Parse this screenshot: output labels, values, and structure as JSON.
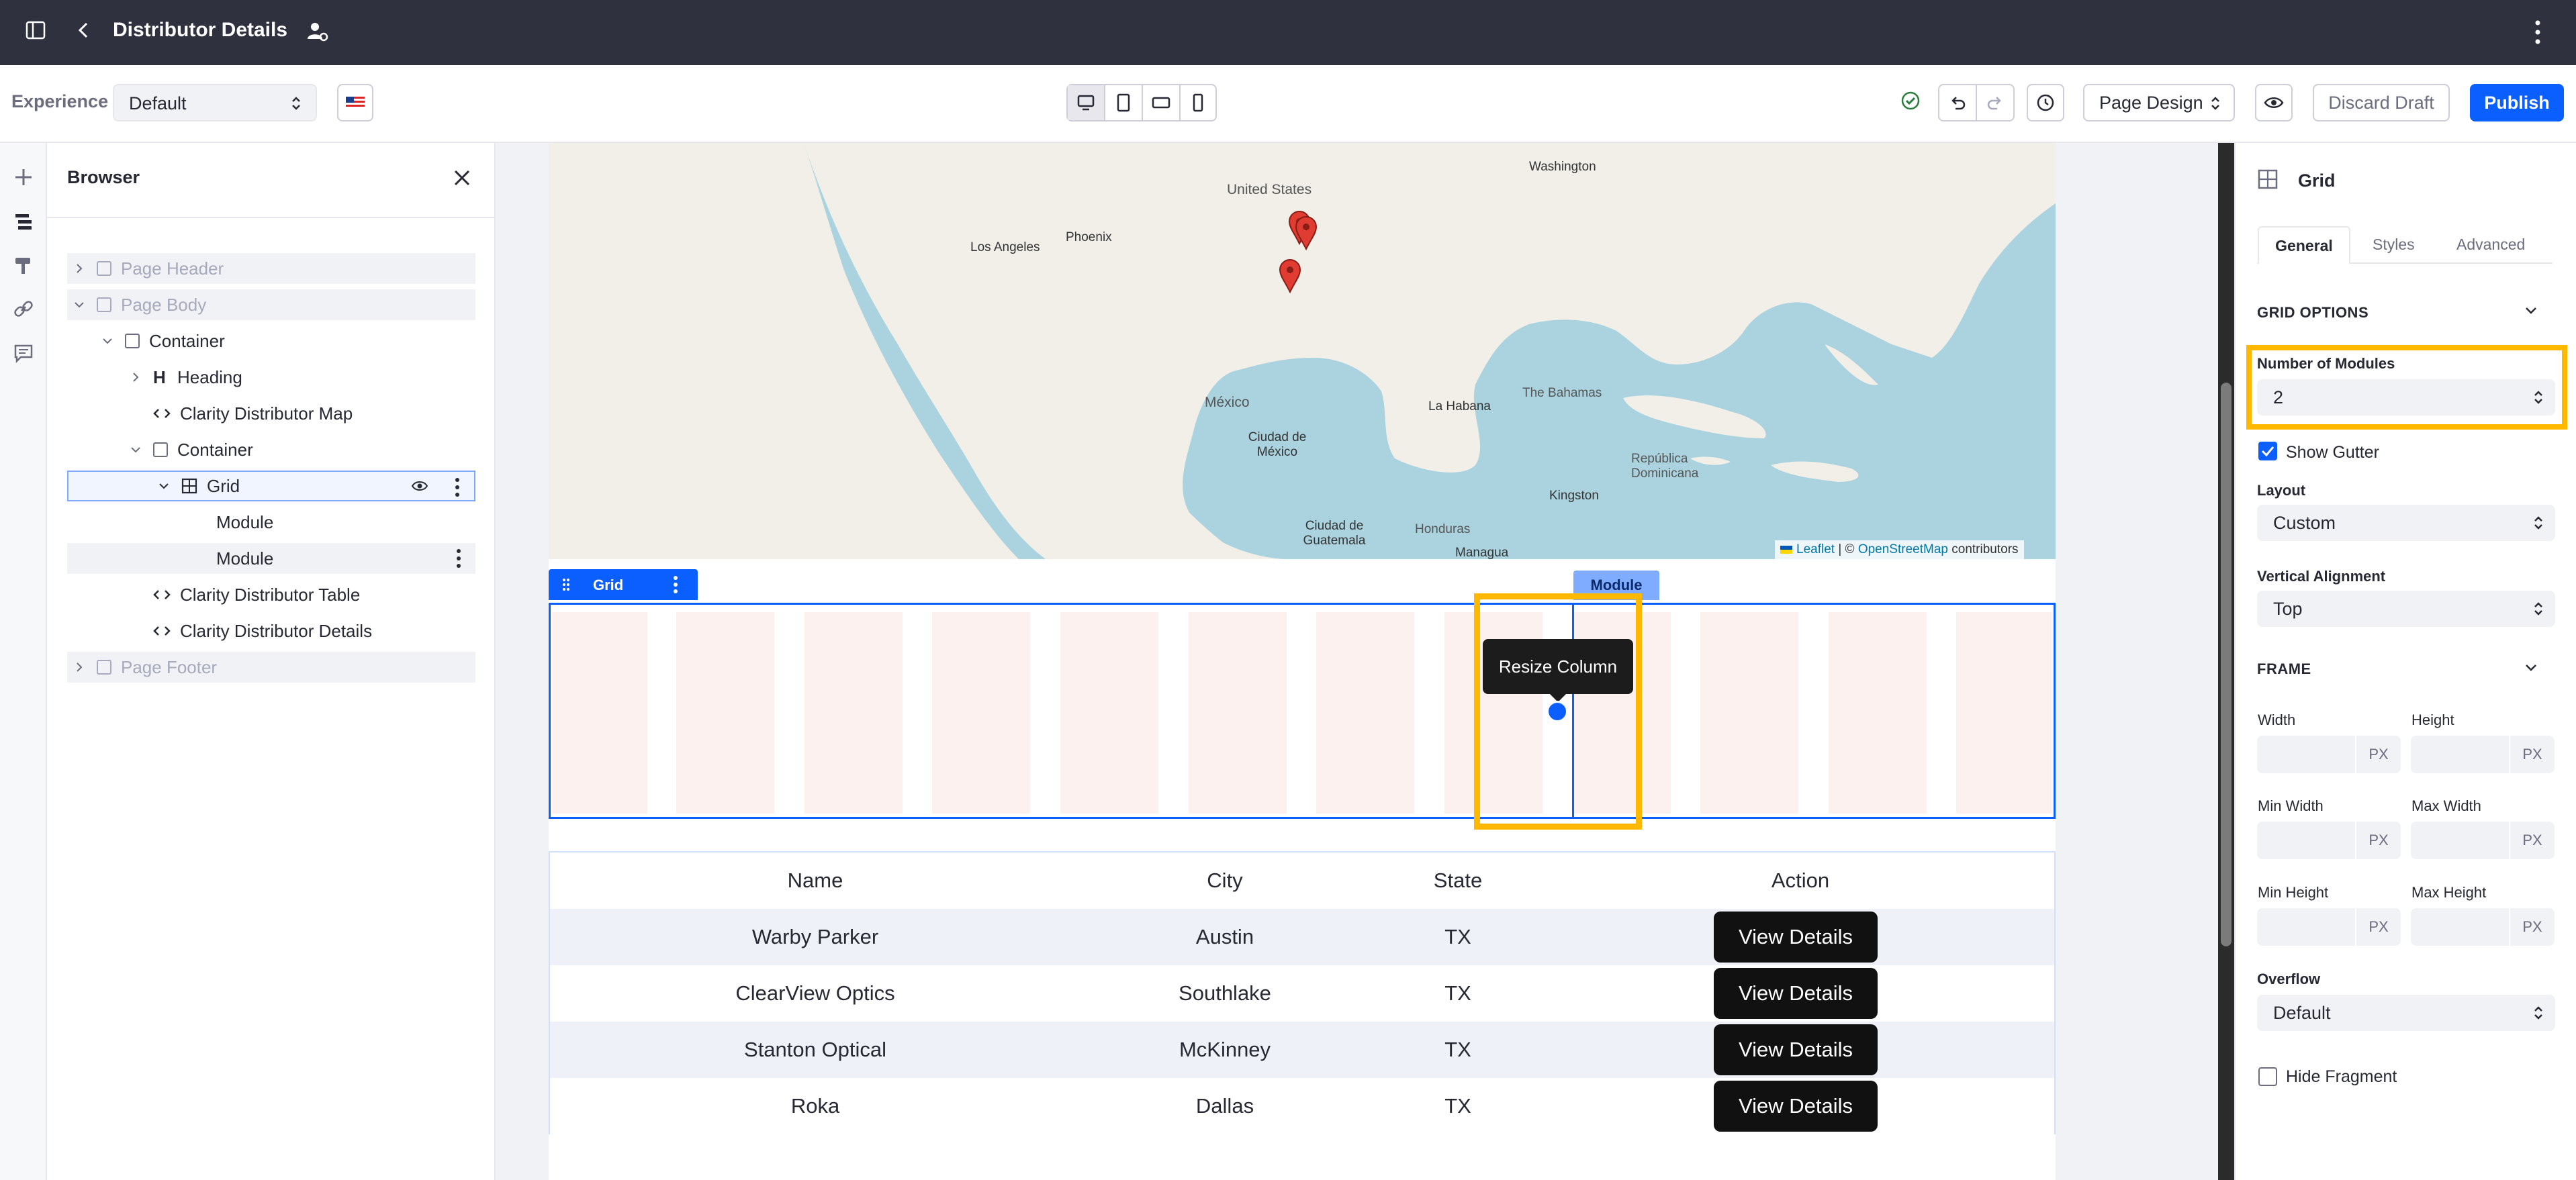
{
  "topbar": {
    "title": "Distributor Details"
  },
  "experience_bar": {
    "label": "Experience",
    "selected": "Default",
    "page_design_label": "Page Design",
    "discard_label": "Discard Draft",
    "publish_label": "Publish"
  },
  "browser": {
    "title": "Browser",
    "items": [
      {
        "label": "Page Header"
      },
      {
        "label": "Page Body"
      },
      {
        "label": "Container"
      },
      {
        "label": "Heading"
      },
      {
        "label": "Clarity Distributor Map"
      },
      {
        "label": "Container"
      },
      {
        "label": "Grid"
      },
      {
        "label": "Module"
      },
      {
        "label": "Module"
      },
      {
        "label": "Clarity Distributor Table"
      },
      {
        "label": "Clarity Distributor Details"
      },
      {
        "label": "Page Footer"
      }
    ]
  },
  "map": {
    "labels": [
      "United States",
      "Washington",
      "Phoenix",
      "Los Angeles",
      "México",
      "Ciudad de México",
      "La Habana",
      "The Bahamas",
      "República Dominicana",
      "Kingston",
      "Ciudad de Guatemala",
      "Honduras",
      "Managua"
    ],
    "attribution": {
      "leaflet": "Leaflet",
      "sep": " | © ",
      "osm": "OpenStreetMap",
      "tail": " contributors"
    }
  },
  "canvas": {
    "grid_tag": "Grid",
    "module_tag": "Module",
    "tooltip": "Resize Column"
  },
  "table": {
    "headers": [
      "Name",
      "City",
      "State",
      "Action"
    ],
    "rows": [
      {
        "name": "Warby Parker",
        "city": "Austin",
        "state": "TX",
        "action": "View Details"
      },
      {
        "name": "ClearView Optics",
        "city": "Southlake",
        "state": "TX",
        "action": "View Details"
      },
      {
        "name": "Stanton Optical",
        "city": "McKinney",
        "state": "TX",
        "action": "View Details"
      },
      {
        "name": "Roka",
        "city": "Dallas",
        "state": "TX",
        "action": "View Details"
      }
    ]
  },
  "panel": {
    "title": "Grid",
    "tabs": [
      "General",
      "Styles",
      "Advanced"
    ],
    "grid_options": "GRID OPTIONS",
    "modules_label": "Number of Modules",
    "modules_value": "2",
    "show_gutter": "Show Gutter",
    "layout_label": "Layout",
    "layout_value": "Custom",
    "valign_label": "Vertical Alignment",
    "valign_value": "Top",
    "frame": "FRAME",
    "width": "Width",
    "height": "Height",
    "min_width": "Min Width",
    "max_width": "Max Width",
    "min_height": "Min Height",
    "max_height": "Max Height",
    "unit": "PX",
    "overflow_label": "Overflow",
    "overflow_value": "Default",
    "hide_fragment": "Hide Fragment"
  },
  "colors": {
    "accent": "#0b5fff",
    "highlight": "#ffb800",
    "topbar": "#30313f"
  }
}
